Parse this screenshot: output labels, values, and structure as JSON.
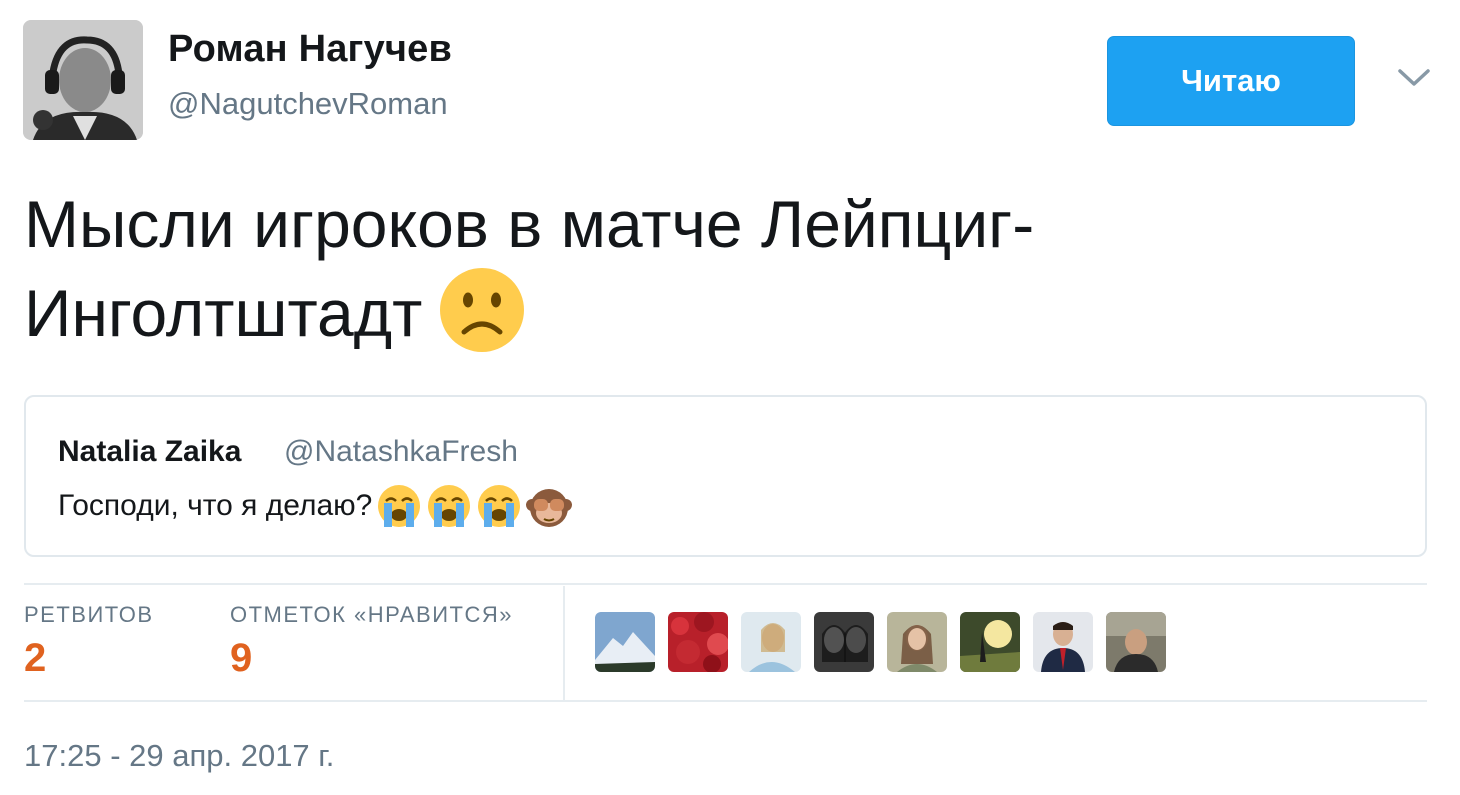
{
  "author": {
    "display_name": "Роман Нагучев",
    "handle": "@NagutchevRoman"
  },
  "follow_button": {
    "label": "Читаю"
  },
  "menu": {
    "icon": "chevron-down-icon"
  },
  "tweet": {
    "text_line1": "Мысли игроков в матче Лейпциг-",
    "text_line2": "Инголтштадт",
    "emoji": "slightly-frowning-face"
  },
  "quoted_tweet": {
    "name": "Natalia Zaika",
    "handle": "@NatashkaFresh",
    "text": "Господи, что я делаю?",
    "emojis": [
      "loudly-crying-face",
      "loudly-crying-face",
      "loudly-crying-face",
      "see-no-evil-monkey"
    ]
  },
  "stats": {
    "retweets_label": "РЕТВИТОВ",
    "retweets_count": "2",
    "likes_label": "ОТМЕТОК «НРАВИТСЯ»",
    "likes_count": "9"
  },
  "likers_count_shown": 8,
  "timestamp": "17:25 - 29 апр. 2017 г.",
  "colors": {
    "accent_blue": "#1da1f2",
    "stat_orange": "#e0621f",
    "muted_gray": "#657786",
    "border": "#e1e8ed"
  }
}
